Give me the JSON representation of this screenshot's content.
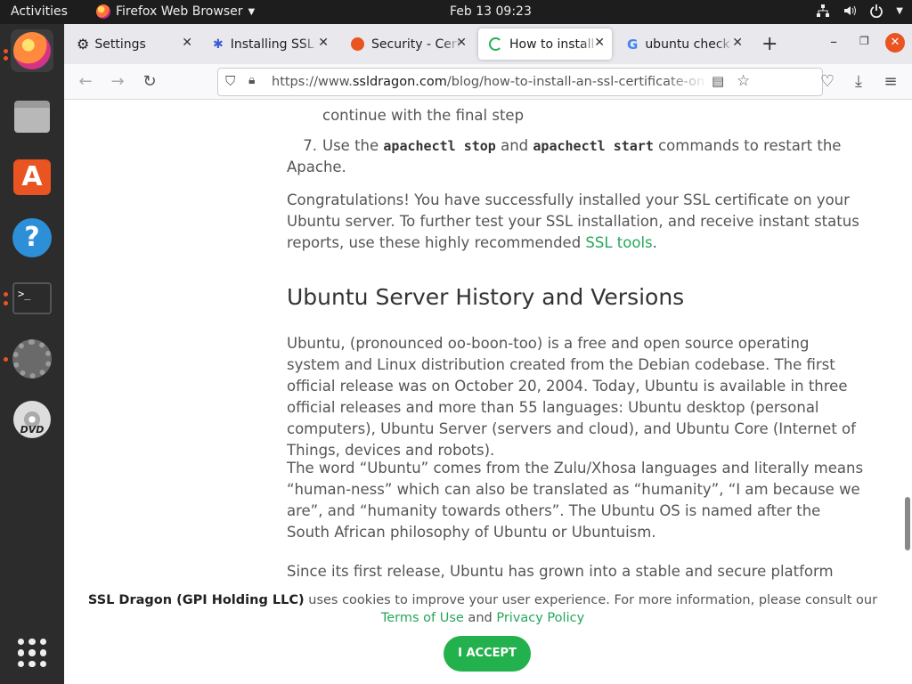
{
  "topbar": {
    "activities": "Activities",
    "app_name": "Firefox Web Browser",
    "clock": "Feb 13  09:23"
  },
  "dock": {
    "items": [
      "firefox",
      "files",
      "software",
      "help",
      "terminal",
      "settings",
      "dvd"
    ]
  },
  "tabs": [
    {
      "label": "Settings",
      "icon": "gear-icon"
    },
    {
      "label": "Installing SSL C",
      "icon": "puzzle-icon"
    },
    {
      "label": "Security - Certi",
      "icon": "ubuntu-icon"
    },
    {
      "label": "How to install",
      "icon": "loading-icon"
    },
    {
      "label": "ubuntu check",
      "icon": "google-icon"
    }
  ],
  "url": {
    "prefix": "https://www.",
    "domain": "ssldragon.com",
    "path": "/blog/how-to-install-an-ssl-certificate-on-u"
  },
  "content": {
    "step6_tail": "continue with the final step",
    "step7_num": "7.",
    "step7_a": "Use the ",
    "step7_cmd1": "apachectl stop",
    "step7_b": " and ",
    "step7_cmd2": "apachectl start",
    "step7_c": " commands to restart the Apache.",
    "congrats": "Congratulations! You have successfully installed your SSL certificate on your Ubuntu server. To further test your SSL installation, and receive instant status reports, use these highly recommended ",
    "ssl_tools": "SSL tools",
    "heading": "Ubuntu Server History and Versions",
    "para1": "Ubuntu, (pronounced oo-boon-too) is a free and open source operating system and Linux distribution created from the Debian codebase. The first official release was on October 20, 2004. Today, Ubuntu is available in three official releases and more than 55 languages: Ubuntu desktop (personal computers), Ubuntu Server (servers and cloud), and Ubuntu Core (Internet of Things, devices and robots).",
    "para2": "The word “Ubuntu” comes from the Zulu/Xhosa languages and literally means “human-ness” which can also be translated as “humanity”, “I am because we are”, and “humanity towards others”. The Ubuntu OS is named after the South African philosophy of Ubuntu or Ubuntuism.",
    "para3": "Since its first release, Ubuntu has grown into a stable and secure platform with"
  },
  "cookie": {
    "brand": "SSL Dragon (GPI Holding LLC)",
    "text": " uses cookies to improve your user experience. For more information, please consult our ",
    "terms": "Terms of Use",
    "and": " and ",
    "privacy": "Privacy Policy",
    "accept": "I ACCEPT"
  },
  "colors": {
    "accent": "#22b14c",
    "link": "#26a65b",
    "ubuntu_orange": "#e95420"
  }
}
